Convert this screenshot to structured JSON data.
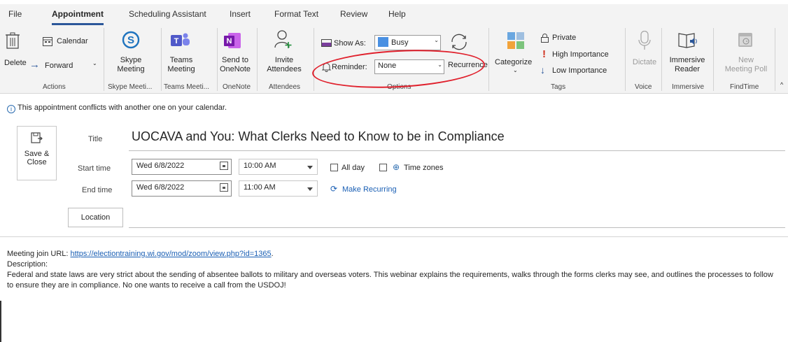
{
  "tabs": [
    {
      "label": "File"
    },
    {
      "label": "Appointment"
    },
    {
      "label": "Scheduling Assistant"
    },
    {
      "label": "Insert"
    },
    {
      "label": "Format Text"
    },
    {
      "label": "Review"
    },
    {
      "label": "Help"
    }
  ],
  "ribbon": {
    "actions": {
      "delete": "Delete",
      "calendar": "Calendar",
      "forward": "Forward",
      "group": "Actions"
    },
    "skype": {
      "line1": "Skype",
      "line2": "Meeting",
      "group": "Skype Meeti..."
    },
    "teams": {
      "line1": "Teams",
      "line2": "Meeting",
      "group": "Teams Meeti..."
    },
    "onenote": {
      "line1": "Send to",
      "line2": "OneNote",
      "group": "OneNote"
    },
    "attendees": {
      "line1": "Invite",
      "line2": "Attendees",
      "group": "Attendees"
    },
    "options": {
      "show_as_label": "Show As:",
      "show_as_value": "Busy",
      "reminder_label": "Reminder:",
      "reminder_value": "None",
      "recurrence": "Recurrence",
      "group": "Options"
    },
    "tags": {
      "categorize": "Categorize",
      "private": "Private",
      "high": "High Importance",
      "low": "Low Importance",
      "group": "Tags"
    },
    "voice": {
      "dictate": "Dictate",
      "group": "Voice"
    },
    "immersive": {
      "line1": "Immersive",
      "line2": "Reader",
      "group": "Immersive"
    },
    "findtime": {
      "line1": "New",
      "line2": "Meeting Poll",
      "group": "FindTime"
    }
  },
  "info_message": "This appointment conflicts with another one on your calendar.",
  "form": {
    "save_close_1": "Save &",
    "save_close_2": "Close",
    "title_label": "Title",
    "title_value": "UOCAVA and You:  What Clerks Need to Know to be in Compliance",
    "start_label": "Start time",
    "start_date": "Wed 6/8/2022",
    "start_time": "10:00 AM",
    "end_label": "End time",
    "end_date": "Wed 6/8/2022",
    "end_time": "11:00 AM",
    "all_day": "All day",
    "time_zones": "Time zones",
    "make_recurring": "Make Recurring",
    "location": "Location"
  },
  "body": {
    "join_prefix": "Meeting join URL: ",
    "join_url": "https://electiontraining.wi.gov/mod/zoom/view.php?id=1365",
    "join_suffix": ".",
    "desc_label": "Description:",
    "desc_text": "Federal and state laws are very strict about the sending of absentee ballots to military and overseas voters. This webinar explains the requirements, walks through the forms clerks may see, and outlines the processes to follow to ensure they are in compliance. No one wants to receive a call from the USDOJ!"
  },
  "colors": {
    "accent": "#2b579a",
    "annotation": "#e0202c",
    "link": "#1a5fb4"
  }
}
